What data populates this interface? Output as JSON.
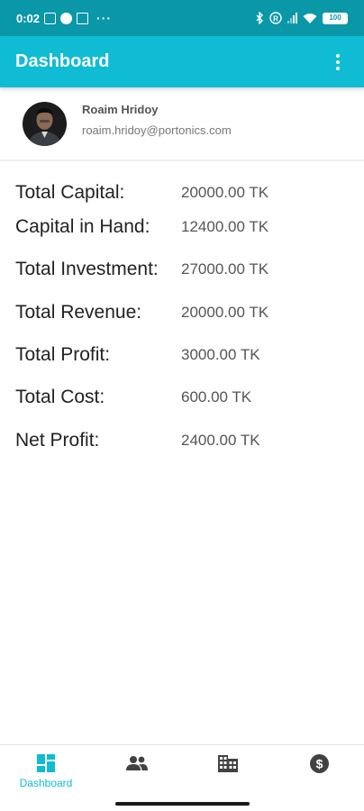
{
  "status_bar": {
    "time": "0:02",
    "battery": "100"
  },
  "app_bar": {
    "title": "Dashboard"
  },
  "profile": {
    "name": "Roaim Hridoy",
    "email": "roaim.hridoy@portonics.com"
  },
  "stats": [
    {
      "label": "Total Capital:",
      "value": "20000.00 TK"
    },
    {
      "label": "Capital in Hand:",
      "value": "12400.00 TK"
    },
    {
      "label": "Total Investment:",
      "value": "27000.00 TK"
    },
    {
      "label": "Total Revenue:",
      "value": "20000.00 TK"
    },
    {
      "label": "Total Profit:",
      "value": "3000.00 TK"
    },
    {
      "label": "Total Cost:",
      "value": "600.00 TK"
    },
    {
      "label": "Net Profit:",
      "value": "2400.00 TK"
    }
  ],
  "bottom_nav": {
    "items": [
      {
        "label": "Dashboard",
        "icon": "dashboard-icon",
        "active": true
      },
      {
        "label": "",
        "icon": "people-icon",
        "active": false
      },
      {
        "label": "",
        "icon": "building-icon",
        "active": false
      },
      {
        "label": "",
        "icon": "dollar-icon",
        "active": false
      }
    ]
  },
  "colors": {
    "status_bar": "#0a97a8",
    "app_bar": "#0fbcd3",
    "active_nav": "#0fbcd3",
    "inactive_nav": "#424242"
  }
}
